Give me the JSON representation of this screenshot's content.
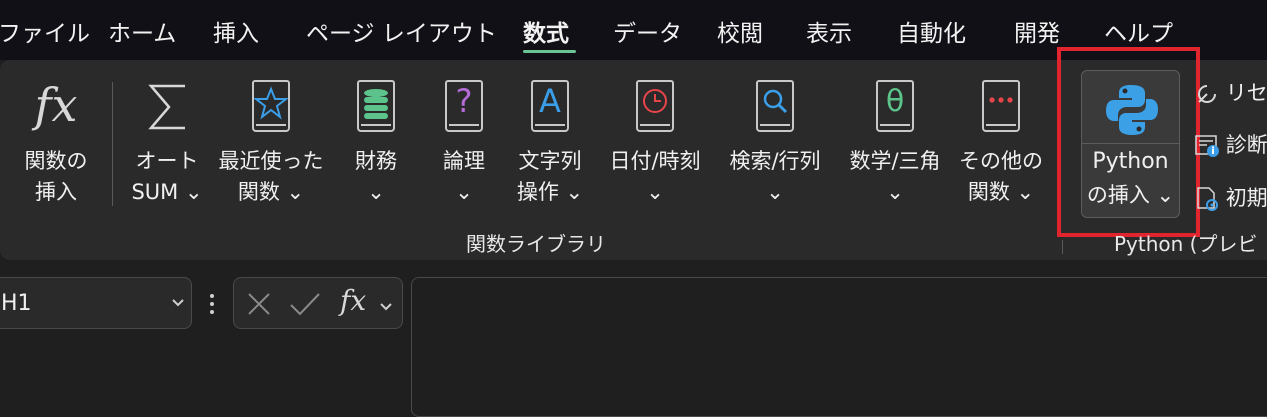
{
  "tabs": [
    {
      "label": "ファイル"
    },
    {
      "label": "ホーム"
    },
    {
      "label": "挿入"
    },
    {
      "label": "ページ レイアウト"
    },
    {
      "label": "数式"
    },
    {
      "label": "データ"
    },
    {
      "label": "校閲"
    },
    {
      "label": "表示"
    },
    {
      "label": "自動化"
    },
    {
      "label": "開発"
    },
    {
      "label": "ヘルプ"
    }
  ],
  "ribbon": {
    "insert_function": {
      "line1": "関数の",
      "line2": "挿入",
      "icon": "fx-icon"
    },
    "library": [
      {
        "line1": "オート",
        "line2": "SUM ⌄",
        "icon": "sigma-icon"
      },
      {
        "line1": "最近使った",
        "line2": "関数 ⌄",
        "icon": "star-book-icon"
      },
      {
        "line1": "財務",
        "line2": "⌄",
        "icon": "coins-book-icon"
      },
      {
        "line1": "論理",
        "line2": "⌄",
        "icon": "question-book-icon"
      },
      {
        "line1": "文字列",
        "line2": "操作 ⌄",
        "icon": "text-book-icon"
      },
      {
        "line1": "日付/時刻",
        "line2": "⌄",
        "icon": "clock-book-icon"
      },
      {
        "line1": "検索/行列",
        "line2": "⌄",
        "icon": "magnifier-book-icon"
      },
      {
        "line1": "数学/三角",
        "line2": "⌄",
        "icon": "theta-book-icon"
      },
      {
        "line1": "その他の",
        "line2": "関数 ⌄",
        "icon": "dots-book-icon"
      }
    ],
    "library_group_label": "関数ライブラリ",
    "python": {
      "line1": "Python",
      "line2": "の挿入 ⌄",
      "group_label": "Python (プレビ",
      "side_items": [
        {
          "label": "リセ",
          "icon": "reset-icon"
        },
        {
          "label": "診断",
          "icon": "diagnostics-icon"
        },
        {
          "label": "初期",
          "icon": "init-icon"
        }
      ]
    }
  },
  "formula_bar": {
    "name_box": "H1",
    "cancel_icon": "x-icon",
    "enter_icon": "check-icon",
    "fx_label": "fx"
  },
  "colors": {
    "accent": "#6bc493",
    "highlight": "#e0252f"
  }
}
